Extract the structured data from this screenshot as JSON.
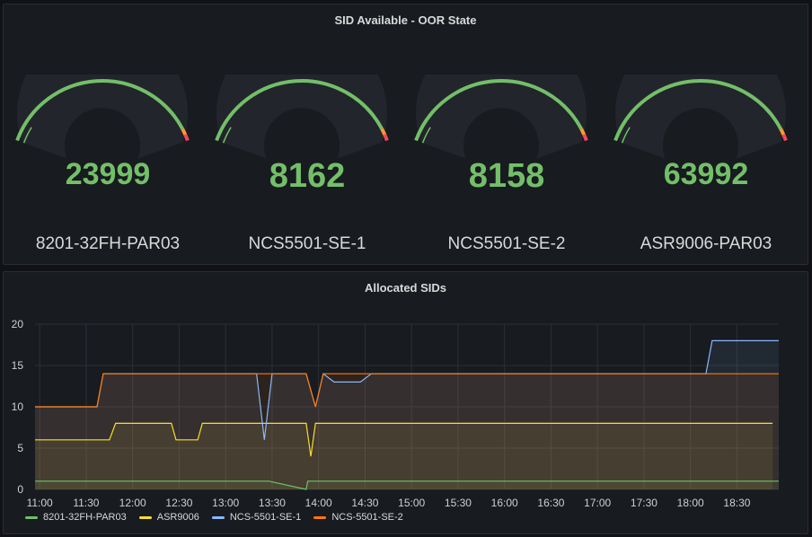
{
  "gauges_panel": {
    "title": "SID Available - OOR State",
    "gauges": [
      {
        "value": "23999",
        "label": "8201-32FH-PAR03",
        "fraction": 0.75
      },
      {
        "value": "8162",
        "label": "NCS5501-SE-1",
        "fraction": 0.85
      },
      {
        "value": "8158",
        "label": "NCS5501-SE-2",
        "fraction": 0.85
      },
      {
        "value": "63992",
        "label": "ASR9006-PAR03",
        "fraction": 0.82
      }
    ],
    "colors": {
      "ok": "#73bf69",
      "warn": "#ff9830",
      "crit": "#f2495c",
      "track": "#22252b"
    }
  },
  "chart_panel": {
    "title": "Allocated SIDs",
    "legend": [
      {
        "name": "8201-32FH-PAR03",
        "color": "#73bf69"
      },
      {
        "name": "ASR9006",
        "color": "#fade2a"
      },
      {
        "name": "NCS-5501-SE-1",
        "color": "#8ab8ff"
      },
      {
        "name": "NCS-5501-SE-2",
        "color": "#ff780a"
      }
    ]
  },
  "chart_data": {
    "type": "area",
    "title": "Allocated SIDs",
    "xlabel": "",
    "ylabel": "",
    "ylim": [
      0,
      20
    ],
    "yticks": [
      0,
      5,
      10,
      15,
      20
    ],
    "xticks": [
      "11:00",
      "11:30",
      "12:00",
      "12:30",
      "13:00",
      "13:30",
      "14:00",
      "14:30",
      "15:00",
      "15:30",
      "16:00",
      "16:30",
      "17:00",
      "17:30",
      "18:00",
      "18:30"
    ],
    "xlim": [
      "10:57",
      "18:57"
    ],
    "grid": true,
    "legend_position": "bottom-left",
    "series": [
      {
        "name": "8201-32FH-PAR03",
        "color": "#73bf69",
        "points": [
          [
            "10:57",
            1
          ],
          [
            "13:28",
            1
          ],
          [
            "13:52",
            0
          ],
          [
            "13:53",
            1
          ],
          [
            "18:57",
            1
          ]
        ]
      },
      {
        "name": "ASR9006",
        "color": "#fade2a",
        "points": [
          [
            "10:57",
            6
          ],
          [
            "11:45",
            6
          ],
          [
            "11:49",
            8
          ],
          [
            "12:25",
            8
          ],
          [
            "12:28",
            6
          ],
          [
            "12:42",
            6
          ],
          [
            "12:45",
            8
          ],
          [
            "13:52",
            8
          ],
          [
            "13:55",
            4
          ],
          [
            "13:58",
            8
          ],
          [
            "18:53",
            8
          ]
        ]
      },
      {
        "name": "NCS-5501-SE-1",
        "color": "#8ab8ff",
        "points": [
          [
            "10:57",
            10
          ],
          [
            "11:37",
            10
          ],
          [
            "11:41",
            14
          ],
          [
            "13:20",
            14
          ],
          [
            "13:25",
            6
          ],
          [
            "13:30",
            14
          ],
          [
            "13:52",
            14
          ],
          [
            "13:58",
            10
          ],
          [
            "14:03",
            14
          ],
          [
            "14:10",
            13
          ],
          [
            "14:27",
            13
          ],
          [
            "14:34",
            14
          ],
          [
            "18:10",
            14
          ],
          [
            "18:14",
            18
          ],
          [
            "18:57",
            18
          ]
        ]
      },
      {
        "name": "NCS-5501-SE-2",
        "color": "#ff780a",
        "points": [
          [
            "10:57",
            10
          ],
          [
            "11:37",
            10
          ],
          [
            "11:41",
            14
          ],
          [
            "13:52",
            14
          ],
          [
            "13:58",
            10
          ],
          [
            "14:03",
            14
          ],
          [
            "18:57",
            14
          ]
        ]
      }
    ]
  }
}
